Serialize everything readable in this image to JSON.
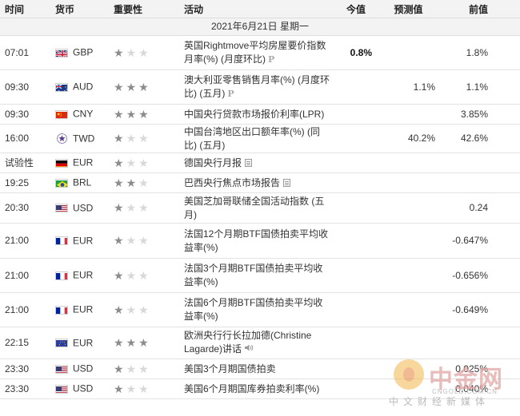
{
  "header": {
    "time": "时间",
    "currency": "货币",
    "importance": "重要性",
    "event": "活动",
    "actual": "今值",
    "forecast": "预测值",
    "previous": "前值"
  },
  "date_label": "2021年6月21日  星期一",
  "rows": [
    {
      "time": "07:01",
      "flag": "gb-flag-icon",
      "currency": "GBP",
      "stars": 1,
      "event": "英国Rightmove平均房屋要价指数月率(%) (月度环比)",
      "icon": "p",
      "actual": "0.8%",
      "forecast": "",
      "previous": "1.8%"
    },
    {
      "time": "09:30",
      "flag": "au-flag-icon",
      "currency": "AUD",
      "stars": 3,
      "event": "澳大利亚零售销售月率(%) (月度环比) (五月)",
      "icon": "p",
      "actual": "",
      "forecast": "1.1%",
      "previous": "1.1%"
    },
    {
      "time": "09:30",
      "flag": "cn-flag-icon",
      "currency": "CNY",
      "stars": 3,
      "event": "中国央行贷款市场报价利率(LPR)",
      "icon": "",
      "actual": "",
      "forecast": "",
      "previous": "3.85%"
    },
    {
      "time": "16:00",
      "flag": "tw-flag-icon",
      "currency": "TWD",
      "stars": 1,
      "event": "中国台湾地区出口额年率(%) (同比) (五月)",
      "icon": "",
      "actual": "",
      "forecast": "40.2%",
      "previous": "42.6%"
    },
    {
      "time": "试验性",
      "flag": "de-flag-icon",
      "currency": "EUR",
      "stars": 1,
      "event": "德国央行月报",
      "icon": "doc",
      "actual": "",
      "forecast": "",
      "previous": ""
    },
    {
      "time": "19:25",
      "flag": "br-flag-icon",
      "currency": "BRL",
      "stars": 2,
      "event": "巴西央行焦点市场报告",
      "icon": "doc",
      "actual": "",
      "forecast": "",
      "previous": ""
    },
    {
      "time": "20:30",
      "flag": "us-flag-icon",
      "currency": "USD",
      "stars": 1,
      "event": "美国芝加哥联储全国活动指数 (五月)",
      "icon": "",
      "actual": "",
      "forecast": "",
      "previous": "0.24"
    },
    {
      "time": "21:00",
      "flag": "fr-flag-icon",
      "currency": "EUR",
      "stars": 1,
      "event": "法国12个月期BTF国债拍卖平均收益率(%)",
      "icon": "",
      "actual": "",
      "forecast": "",
      "previous": "-0.647%"
    },
    {
      "time": "21:00",
      "flag": "fr-flag-icon",
      "currency": "EUR",
      "stars": 1,
      "event": "法国3个月期BTF国债拍卖平均收益率(%)",
      "icon": "",
      "actual": "",
      "forecast": "",
      "previous": "-0.656%"
    },
    {
      "time": "21:00",
      "flag": "fr-flag-icon",
      "currency": "EUR",
      "stars": 1,
      "event": "法国6个月期BTF国债拍卖平均收益率(%)",
      "icon": "",
      "actual": "",
      "forecast": "",
      "previous": "-0.649%"
    },
    {
      "time": "22:15",
      "flag": "eu-flag-icon",
      "currency": "EUR",
      "stars": 3,
      "event": "欧洲央行行长拉加德(Christine Lagarde)讲话",
      "icon": "speaker",
      "actual": "",
      "forecast": "",
      "previous": ""
    },
    {
      "time": "23:30",
      "flag": "us-flag-icon",
      "currency": "USD",
      "stars": 1,
      "event": "美国3个月期国债拍卖",
      "icon": "",
      "actual": "",
      "forecast": "",
      "previous": "0.025%"
    },
    {
      "time": "23:30",
      "flag": "us-flag-icon",
      "currency": "USD",
      "stars": 1,
      "event": "美国6个月期国库券拍卖利率(%)",
      "icon": "",
      "actual": "",
      "forecast": "",
      "previous": "0.040%"
    }
  ],
  "watermark": {
    "brand": "中金网",
    "url": "CNGOLD.COM.CN",
    "tagline": "中文财经新媒体"
  }
}
